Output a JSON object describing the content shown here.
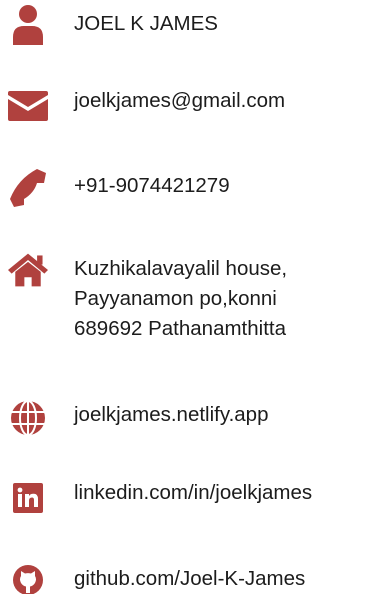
{
  "accent": "#b0413e",
  "contact": {
    "name": {
      "icon": "user-icon",
      "text": "JOEL K JAMES"
    },
    "email": {
      "icon": "envelope-icon",
      "text": "joelkjames@gmail.com"
    },
    "phone": {
      "icon": "phone-icon",
      "text": "+91-9074421279"
    },
    "address": {
      "icon": "home-icon",
      "lines": [
        "Kuzhikalavayalil house,",
        "Payyanamon po,konni",
        "689692 Pathanamthitta"
      ]
    },
    "website": {
      "icon": "globe-icon",
      "text": "joelkjames.netlify.app"
    },
    "linkedin": {
      "icon": "linkedin-icon",
      "text": "linkedin.com/in/joelkjames"
    },
    "github": {
      "icon": "github-icon",
      "text": "github.com/Joel-K-James"
    }
  }
}
